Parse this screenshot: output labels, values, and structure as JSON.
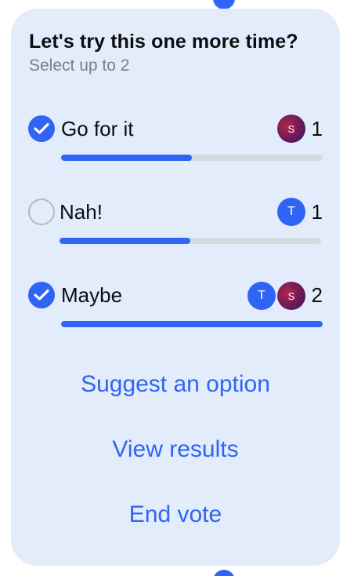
{
  "poll": {
    "title": "Let's try this one more time?",
    "subtitle": "Select up to 2",
    "options": [
      {
        "label": "Go for it",
        "selected": true,
        "votes": "1",
        "voters": [
          "S"
        ],
        "fraction": 0.5
      },
      {
        "label": "Nah!",
        "selected": false,
        "votes": "1",
        "voters": [
          "T"
        ],
        "fraction": 0.5
      },
      {
        "label": "Maybe",
        "selected": true,
        "votes": "2",
        "voters": [
          "T",
          "S"
        ],
        "fraction": 1.0
      }
    ]
  },
  "actions": {
    "suggest": "Suggest an option",
    "view_results": "View results",
    "end_vote": "End vote"
  },
  "colors": {
    "accent": "#2f64f5",
    "card_background": "#e3ecfb",
    "track": "#d5d9e0"
  }
}
